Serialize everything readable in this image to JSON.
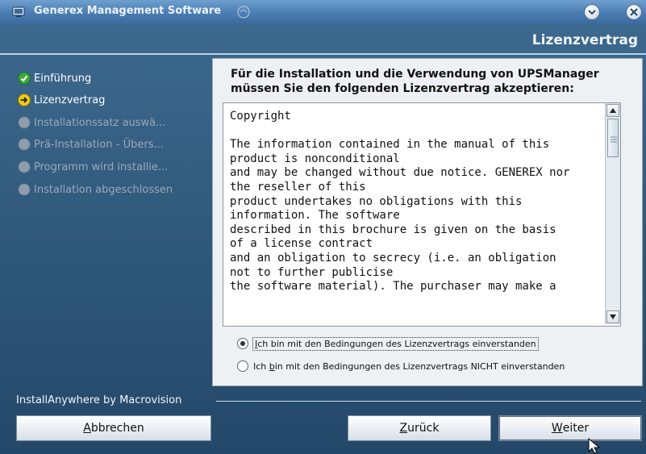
{
  "window": {
    "title": "Generex Management Software",
    "minimize_icon": "chevron-down-icon",
    "close_icon": "close-icon"
  },
  "page": {
    "title": "Lizenzvertrag"
  },
  "steps": [
    {
      "label": "Einführung",
      "state": "done",
      "icon": "check-icon"
    },
    {
      "label": "Lizenzvertrag",
      "state": "current",
      "icon": "arrow-right-icon"
    },
    {
      "label": "Installationssatz auswä...",
      "state": "pending",
      "icon": "circle-icon"
    },
    {
      "label": "Prä-Installation - Übers...",
      "state": "pending",
      "icon": "circle-icon"
    },
    {
      "label": "Programm wird installie...",
      "state": "pending",
      "icon": "circle-icon"
    },
    {
      "label": "Installation abgeschlossen",
      "state": "pending",
      "icon": "circle-icon"
    }
  ],
  "content": {
    "intro_line1": "Für die Installation und die Verwendung von UPSManager",
    "intro_line2": "müssen Sie den folgenden Lizenzvertrag akzeptieren:",
    "license_text": "Copyright\n\nThe information contained in the manual of this\nproduct is nonconditional\nand may be changed without due notice. GENEREX nor\nthe reseller of this\nproduct undertakes no obligations with this\ninformation. The software\ndescribed in this brochure is given on the basis\nof a license contract\nand an obligation to secrecy (i.e. an obligation\nnot to further publicise\nthe software material). The purchaser may make a",
    "radio_accept": {
      "prefix": "",
      "mnemonic": "I",
      "rest": "ch bin mit den Bedingungen des Lizenzvertrags einverstanden",
      "selected": true
    },
    "radio_decline": {
      "prefix": "Ich ",
      "mnemonic": "b",
      "rest": "in mit den Bedingungen des Lizenzvertrags NICHT einverstanden",
      "selected": false
    }
  },
  "footer": {
    "vendor": "InstallAnywhere by Macrovision"
  },
  "buttons": {
    "cancel": {
      "mnemonic": "A",
      "rest": "bbrechen"
    },
    "back": {
      "mnemonic": "Z",
      "rest": "urück"
    },
    "next": {
      "mnemonic": "W",
      "rest": "eiter"
    }
  },
  "colors": {
    "window_bg": "#2f5878",
    "titlebar": "#4d7fb4",
    "done": "#3aa63a",
    "current": "#e6c200",
    "pending": "#8e9eae"
  }
}
